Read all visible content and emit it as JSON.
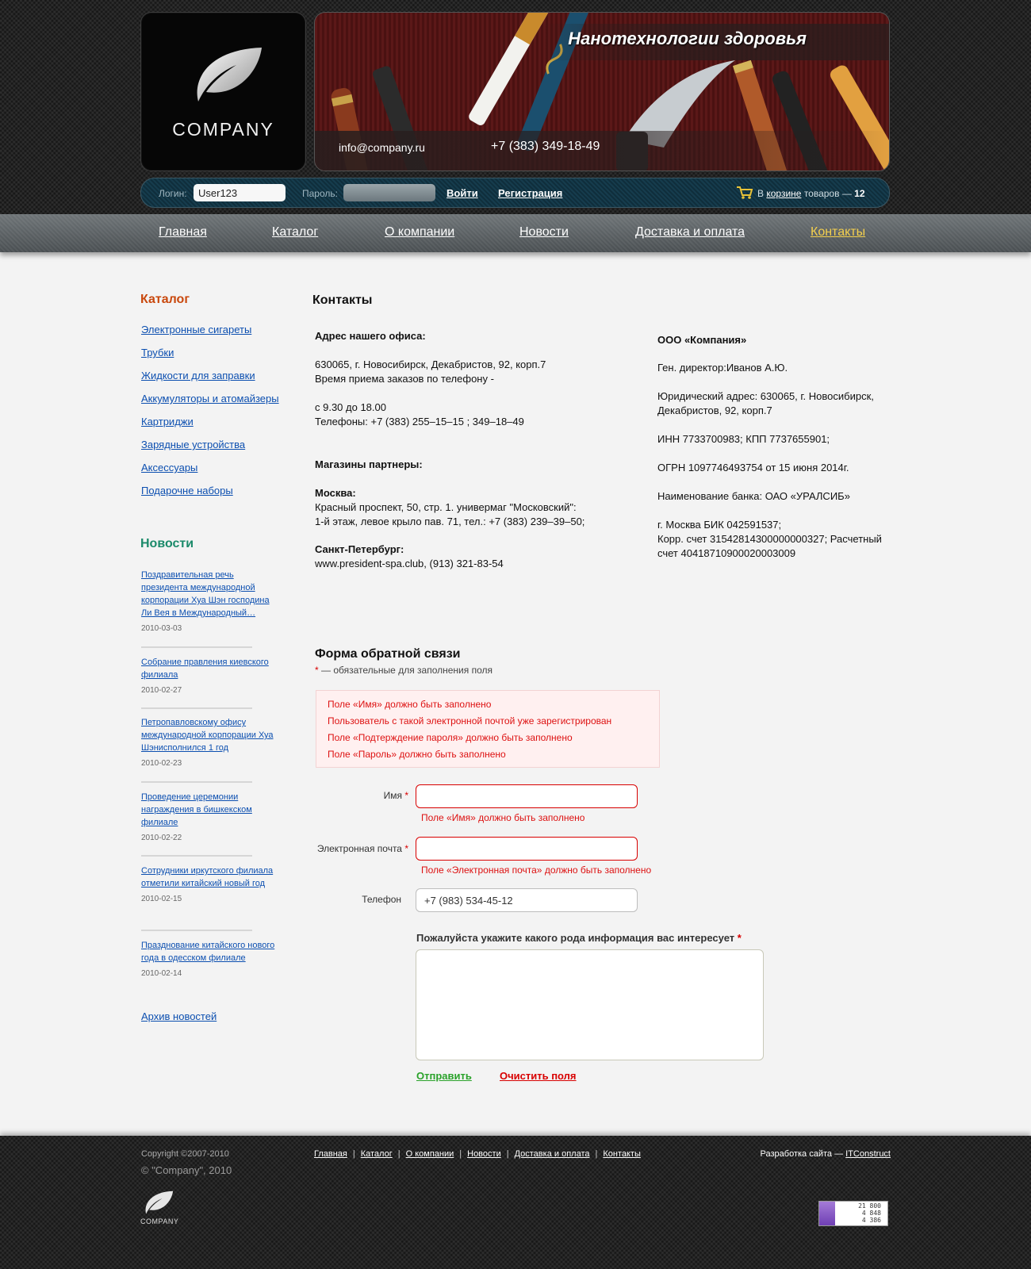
{
  "header": {
    "logo_text": "COMPANY",
    "banner_title": "Нанотехнологии здоровья",
    "email": "info@company.ru",
    "phone": "+7 (383) 349-18-49"
  },
  "loginbar": {
    "login_label": "Логин:",
    "login_value": "User123",
    "password_label": "Пароль:",
    "login_button": "Войти",
    "register_button": "Регистрация",
    "cart_prefix": "В",
    "cart_link": "корзине",
    "cart_suffix": "товаров —",
    "cart_count": "12"
  },
  "nav": {
    "items": [
      "Главная",
      "Каталог",
      "О компании",
      "Новости",
      "Доставка и оплата",
      "Контакты"
    ],
    "active": "Контакты"
  },
  "sidebar": {
    "catalog_title": "Каталог",
    "catalog_items": [
      "Электронные сигареты",
      "Трубки",
      "Жидкости для заправки",
      "Аккумуляторы и атомайзеры",
      "Картриджи",
      "Зарядные устройства",
      "Аксессуары",
      "Подарочне наборы"
    ],
    "news_title": "Новости",
    "news": [
      {
        "title": "Поздравительная речь президента международной корпорации Хуа Шэн господина Ли Вея в Международный…",
        "date": "2010-03-03"
      },
      {
        "title": "Собрание правления киевского филиала",
        "date": "2010-02-27"
      },
      {
        "title": "Петропавловскому офису международной корпорации Хуа Шэнисполнился 1 год",
        "date": "2010-02-23"
      },
      {
        "title": "Проведение церемонии награждения в бишкекском филиале",
        "date": "2010-02-22"
      },
      {
        "title": "Сотрудники иркутского филиала отметили китайский новый год",
        "date": "2010-02-15"
      },
      {
        "title": "Празднование китайского нового года в одесском филиале",
        "date": "2010-02-14"
      }
    ],
    "news_archive": "Архив новостей"
  },
  "main": {
    "title": "Контакты",
    "office_heading": "Адрес нашего офиса:",
    "office_text": "630065, г. Новосибирск, Декабристов, 92, корп.7\nВремя приема заказов по телефону -\n\nс 9.30 до 18.00\nТелефоны: +7 (383) 255–15–15 ; 349–18–49",
    "partners_heading": "Магазины партнеры:",
    "moscow_heading": "Москва:",
    "moscow_text": "Красный проспект, 50, стр. 1. универмаг \"Московский\":\n1-й этаж, левое крыло пав. 71,  тел.: +7 (383) 239–39–50;",
    "spb_heading": "Санкт-Петербург:",
    "spb_text": "www.president-spa.club, (913) 321-83-54",
    "company_name": "ООО «Компания»",
    "requisites": "Ген. директор:Иванов А.Ю.\n\nЮридический адрес: 630065, г. Новосибирск,\nДекабристов, 92, корп.7\n\nИНН 7733700983; КПП 7737655901;\n\nОГРН 1097746493754 от 15 июня 2014г.\n\nНаименование банка: ОАО «УРАЛСИБ»\n\nг. Москва БИК 042591537;\nКорр. счет 31542814300000000327; Расчетный\nсчет 40418710900020003009"
  },
  "form": {
    "title": "Форма обратной связи",
    "required_star": "*",
    "required_note": "— обязательные для заполнения поля",
    "errors": [
      "Поле «Имя» должно быть заполнено",
      "Пользователь с такой электронной почтой уже зарегистрирован",
      "Поле «Подтерждение пароля» должно быть заполнено",
      "Поле «Пароль» должно быть заполнено"
    ],
    "name_label": "Имя",
    "name_value": "",
    "name_error": "Поле «Имя» должно быть заполнено",
    "email_label": "Электронная почта",
    "email_value": "",
    "email_error": "Поле «Электронная почта» должно быть заполнено",
    "phone_label": "Телефон",
    "phone_value": "+7 (983) 534-45-12",
    "question_label": "Пожалуйста укажите какого рода информация вас интересует",
    "question_value": "",
    "submit": "Отправить",
    "clear": "Очистить поля"
  },
  "footer": {
    "copyright": "Copyright ©2007-2010",
    "copyright2": "© \"Company\", 2010",
    "logo_text": "COMPANY",
    "nav": [
      "Главная",
      "Каталог",
      "О компании",
      "Новости",
      "Доставка и оплата",
      "Контакты"
    ],
    "dev_prefix": "Разработка сайта —",
    "dev_link": "ITConstruct",
    "counter": [
      "21 800",
      "4 848",
      "4 386"
    ]
  },
  "colors": {
    "link": "#0c4fb0",
    "catalog_heading": "#c9480d",
    "news_heading": "#1b8a6a",
    "error": "#d11111",
    "nav_active": "#f4d04e",
    "submit": "#2aa22a"
  },
  "icons": [
    "leaf-logo-icon",
    "cart-icon",
    "counter-chart-icon"
  ]
}
